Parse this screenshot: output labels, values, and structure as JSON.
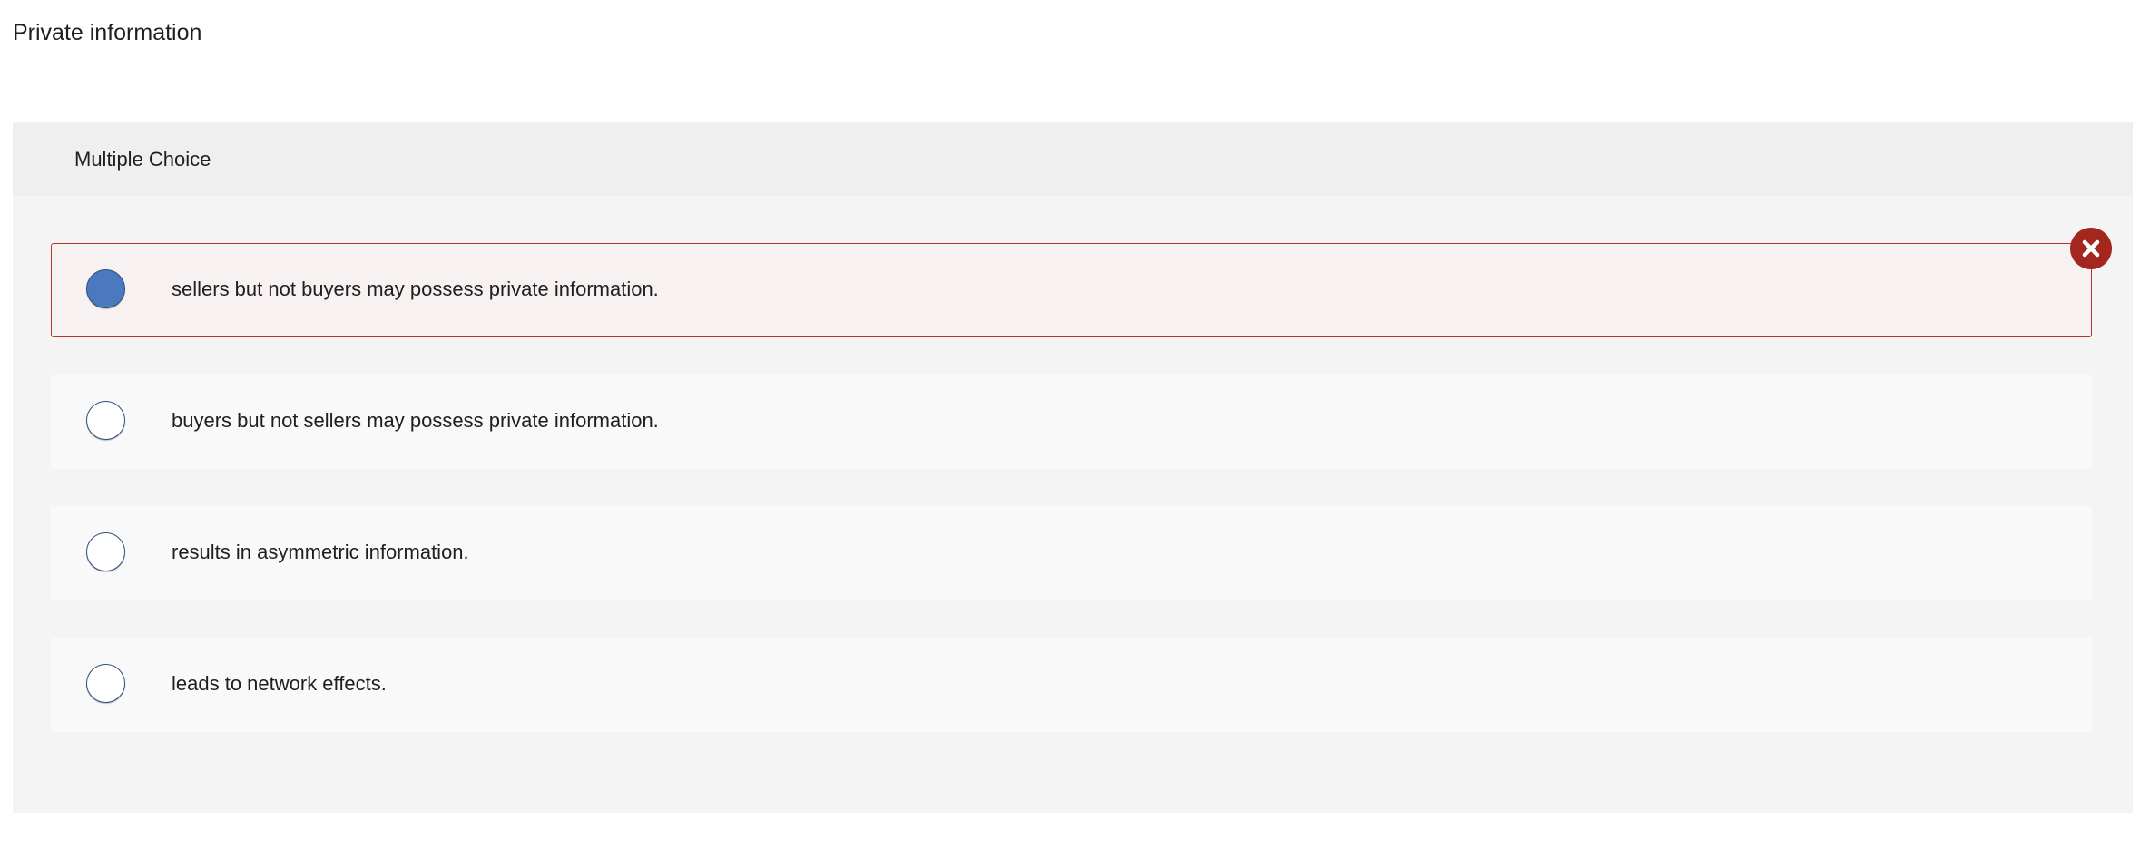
{
  "page": {
    "title": "Private information"
  },
  "question": {
    "type_label": "Multiple Choice",
    "options": [
      {
        "label": "sellers but not buyers may possess private information.",
        "selected": true,
        "result": "incorrect"
      },
      {
        "label": "buyers but not sellers may possess private information.",
        "selected": false
      },
      {
        "label": "results in asymmetric information.",
        "selected": false
      },
      {
        "label": "leads to network effects.",
        "selected": false
      }
    ],
    "result_icon": "x-circle-icon"
  },
  "colors": {
    "selected_fill": "#4b79c0",
    "radio_border": "#2d4f7f",
    "incorrect_accent": "#a4271f",
    "selected_background": "#f8f1f1",
    "card_background": "#f4f4f4"
  }
}
